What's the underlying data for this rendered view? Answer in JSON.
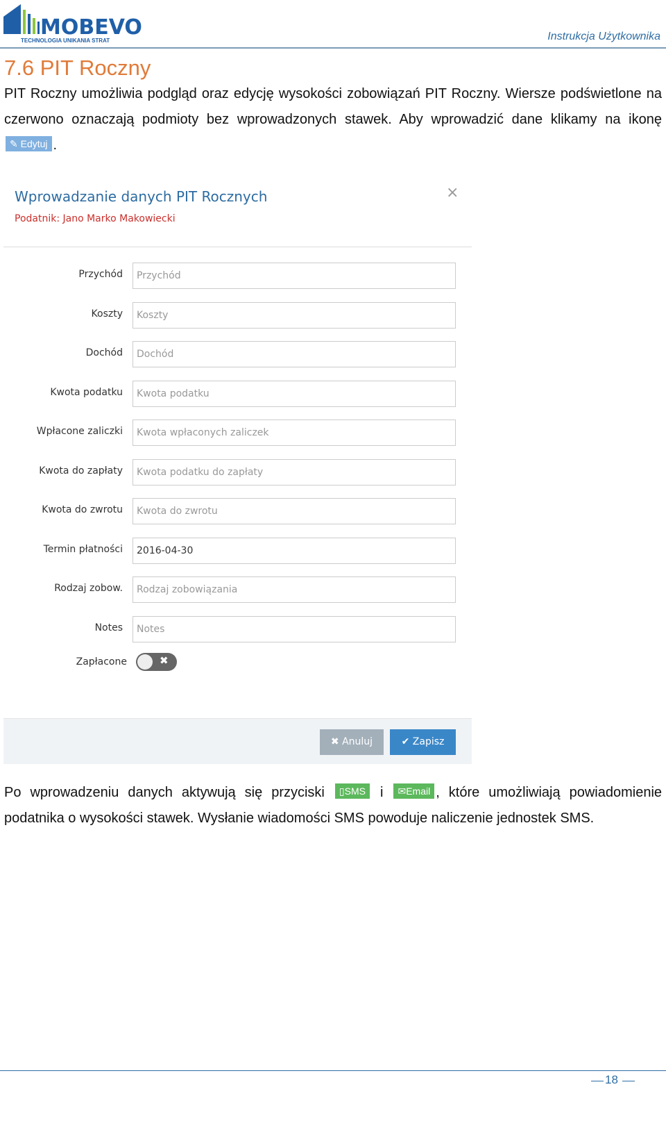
{
  "header": {
    "logo_text": "MOBEVO",
    "logo_tagline": "TECHNOLOGIA UNIKANIA STRAT",
    "doc_title": "Instrukcja Użytkownika"
  },
  "section": {
    "title": "7.6 PIT Roczny",
    "intro_before": "PIT Roczny umożliwia podgląd oraz edycję wysokości zobowiązań PIT Roczny. Wiersze podświetlone na czerwono oznaczają podmioty bez wprowadzonych stawek. Aby wprowadzić dane klikamy na ikonę",
    "intro_after": ".",
    "edit_button": "Edytuj",
    "outro_1": "Po wprowadzeniu danych aktywują się przyciski",
    "outro_and": "i",
    "outro_2": ", które umożliwiają powiadomienie podatnika o wysokości stawek. Wysłanie wiadomości SMS powoduje naliczenie jednostek SMS.",
    "sms_button": "SMS",
    "email_button": "Email"
  },
  "dialog": {
    "title": "Wprowadzanie danych PIT Rocznych",
    "subtitle": "Podatnik: Jano Marko Makowiecki",
    "close": "×",
    "fields": [
      {
        "label": "Przychód",
        "placeholder": "Przychód",
        "value": ""
      },
      {
        "label": "Koszty",
        "placeholder": "Koszty",
        "value": ""
      },
      {
        "label": "Dochód",
        "placeholder": "Dochód",
        "value": ""
      },
      {
        "label": "Kwota podatku",
        "placeholder": "Kwota podatku",
        "value": ""
      },
      {
        "label": "Wpłacone zaliczki",
        "placeholder": "Kwota wpłaconych zaliczek",
        "value": ""
      },
      {
        "label": "Kwota do zapłaty",
        "placeholder": "Kwota podatku do zapłaty",
        "value": ""
      },
      {
        "label": "Kwota do zwrotu",
        "placeholder": "Kwota do zwrotu",
        "value": ""
      },
      {
        "label": "Termin płatności",
        "placeholder": "",
        "value": "2016-04-30"
      },
      {
        "label": "Rodzaj zobow.",
        "placeholder": "Rodzaj zobowiązania",
        "value": ""
      },
      {
        "label": "Notes",
        "placeholder": "Notes",
        "value": ""
      }
    ],
    "paid_label": "Zapłacone",
    "paid_state": false,
    "cancel": "Anuluj",
    "save": "Zapisz"
  },
  "page_number": "18",
  "colors": {
    "accent": "#2e6da4",
    "heading": "#e07b39",
    "sms_green": "#5cb85c",
    "cancel_gray": "#a3b0ba",
    "save_blue": "#3a87c8"
  }
}
